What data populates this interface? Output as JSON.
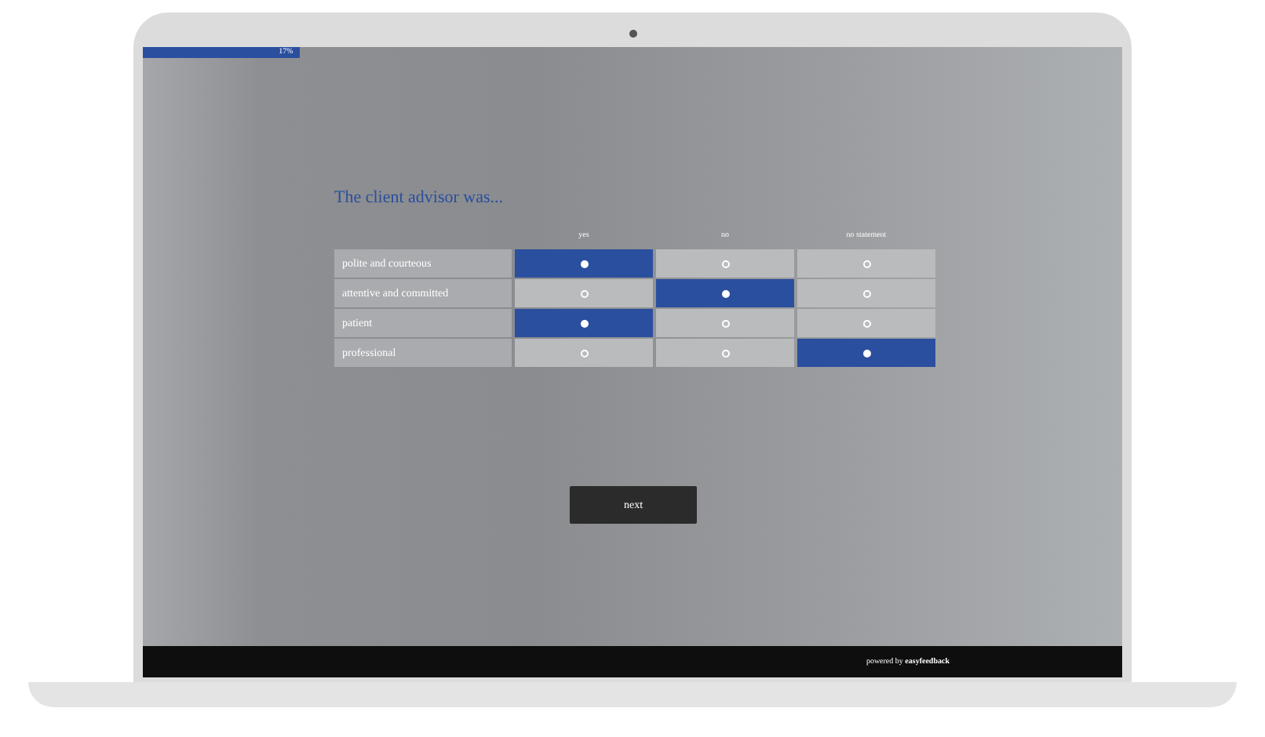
{
  "progress": {
    "level": 0.16,
    "label": "17%"
  },
  "question": {
    "title": "The client advisor was...",
    "columns": [
      "yes",
      "no",
      "no statement"
    ],
    "rows": [
      {
        "label": "polite and courteous",
        "options": [
          {
            "selected": true
          },
          {
            "selected": false
          },
          {
            "selected": false
          }
        ]
      },
      {
        "label": "attentive and committed",
        "options": [
          {
            "selected": false
          },
          {
            "selected": true
          },
          {
            "selected": false
          }
        ]
      },
      {
        "label": "patient",
        "options": [
          {
            "selected": true
          },
          {
            "selected": false
          },
          {
            "selected": false
          }
        ]
      },
      {
        "label": "professional",
        "options": [
          {
            "selected": false
          },
          {
            "selected": false
          },
          {
            "selected": true
          }
        ]
      }
    ]
  },
  "next_button": "next",
  "footer": "powered by **easyfeedback**"
}
